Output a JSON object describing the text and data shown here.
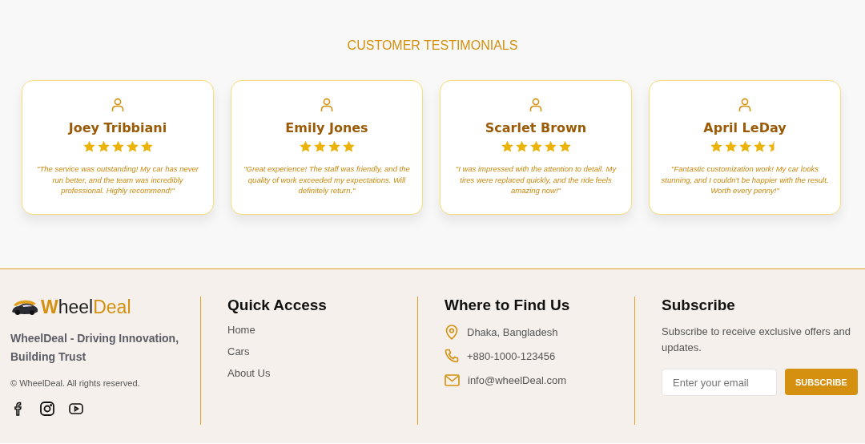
{
  "section_title": "CUSTOMER TESTIMONIALS",
  "testimonials": [
    {
      "name": "Joey Tribbiani",
      "stars": 5,
      "quote": "\"The service was outstanding! My car has never run better, and the team was incredibly professional. Highly recommend!\""
    },
    {
      "name": "Emily Jones",
      "stars": 4,
      "quote": "\"Great experience! The staff was friendly, and the quality of work exceeded my expectations. Will definitely return.\""
    },
    {
      "name": "Scarlet Brown",
      "stars": 5,
      "quote": "\"I was impressed with the attention to detail. My tires were replaced quickly, and the ride feels amazing now!\""
    },
    {
      "name": "April LeDay",
      "stars": 4.5,
      "quote": "\"Fantastic customization work! My car looks stunning, and I couldn't be happier with the result. Worth every penny!\""
    }
  ],
  "footer": {
    "brand": {
      "logo_parts": [
        "W",
        "heel",
        "Deal"
      ],
      "tagline": "WheelDeal - Driving Innovation, Building Trust",
      "copyright": "© WheelDeal. All rights reserved.",
      "socials": [
        {
          "kind": "facebook"
        },
        {
          "kind": "instagram"
        },
        {
          "kind": "youtube"
        }
      ]
    },
    "quick_access": {
      "title": "Quick Access",
      "links": [
        "Home",
        "Cars",
        "About Us"
      ]
    },
    "find_us": {
      "title": "Where to Find Us",
      "items": [
        {
          "kind": "location",
          "text": "Dhaka, Bangladesh"
        },
        {
          "kind": "phone",
          "text": "+880-1000-123456"
        },
        {
          "kind": "email",
          "text": "info@wheelDeal.com"
        }
      ]
    },
    "subscribe": {
      "title": "Subscribe",
      "text": "Subscribe to receive exclusive offers and updates.",
      "placeholder": "Enter your email",
      "button": "SUBSCRIBE"
    }
  }
}
